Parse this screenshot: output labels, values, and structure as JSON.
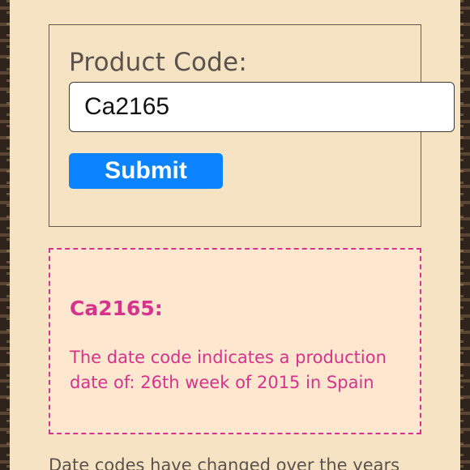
{
  "form": {
    "label": "Product Code:",
    "input_value": "Ca2165",
    "submit_label": "Submit"
  },
  "result": {
    "code_heading": "Ca2165:",
    "message": "The date code indicates a production date of: 26th week of 2015 in Spain"
  },
  "footer": {
    "text": "Date codes have changed over the years"
  },
  "colors": {
    "page_background": "#f6e3c3",
    "accent_pink": "#d6338c",
    "button_blue": "#0d84ff"
  }
}
